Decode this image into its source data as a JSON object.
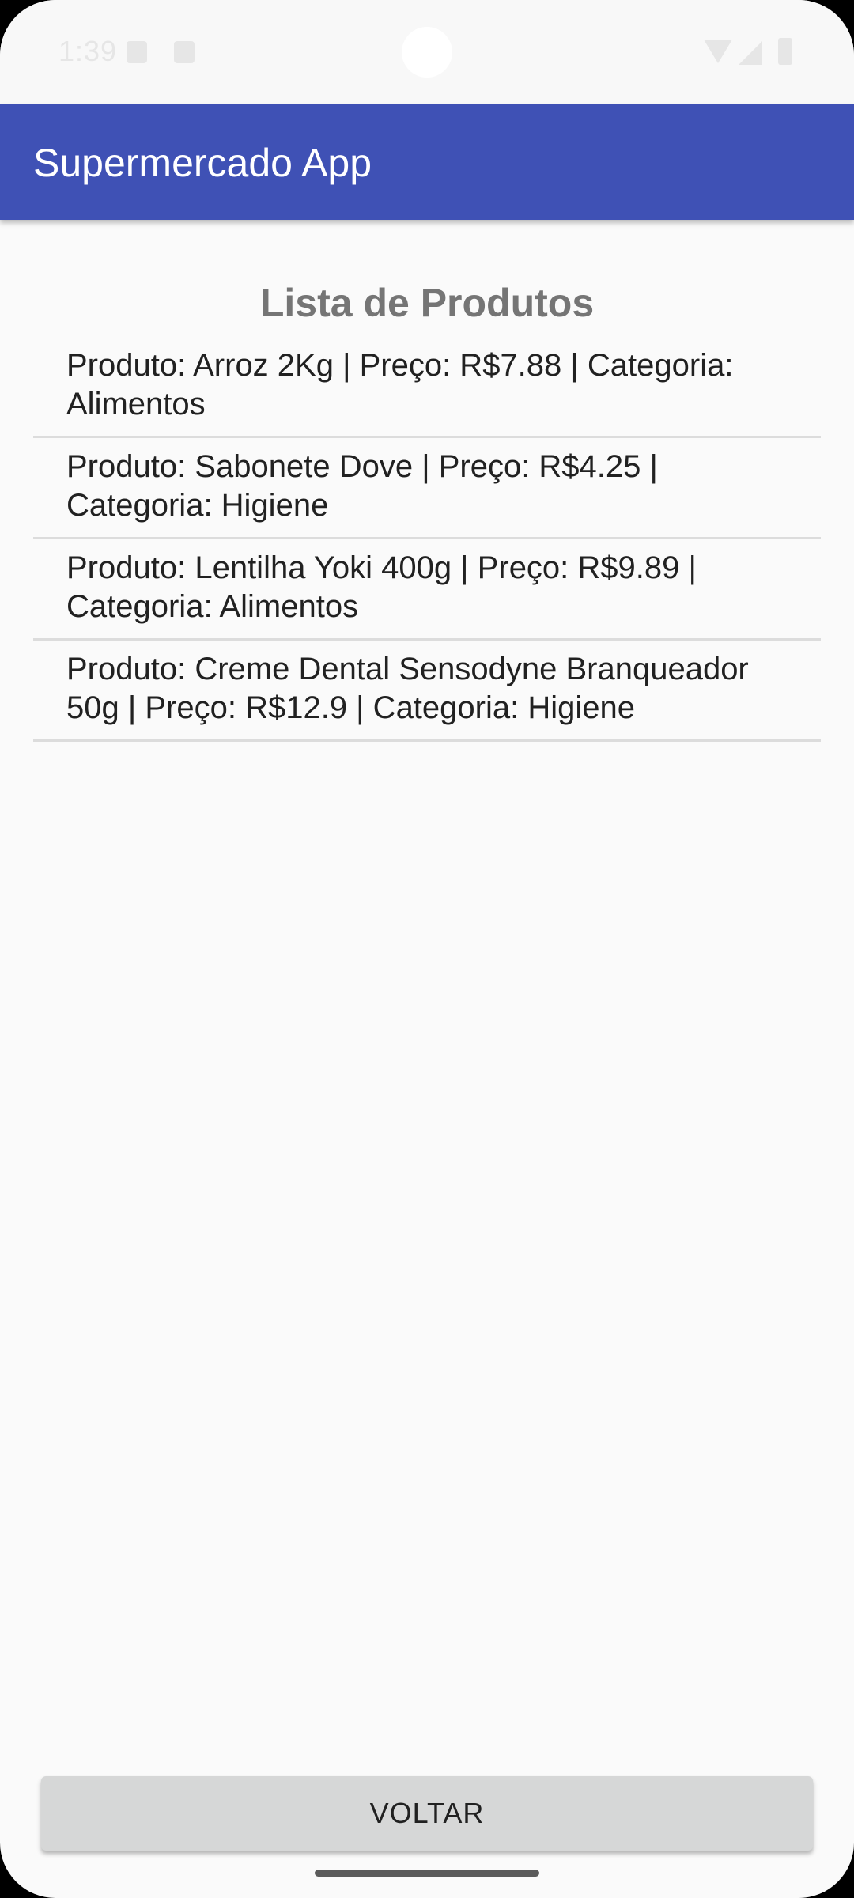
{
  "status_bar": {
    "time": "1:39",
    "icons": [
      "notification-icon",
      "notification-icon",
      "wifi-icon",
      "signal-icon",
      "battery-icon"
    ]
  },
  "app_bar": {
    "title": "Supermercado App",
    "color": "#3f51b5"
  },
  "main": {
    "title": "Lista de Produtos",
    "items": [
      {
        "text": "Produto: Arroz 2Kg | Preço: R$7.88 | Categoria: Alimentos"
      },
      {
        "text": "Produto: Sabonete Dove | Preço: R$4.25 | Categoria: Higiene"
      },
      {
        "text": "Produto: Lentilha Yoki 400g | Preço: R$9.89 | Categoria: Alimentos"
      },
      {
        "text": "Produto: Creme Dental Sensodyne Branqueador 50g | Preço: R$12.9 | Categoria: Higiene"
      }
    ]
  },
  "footer": {
    "back_label": "VOLTAR"
  }
}
